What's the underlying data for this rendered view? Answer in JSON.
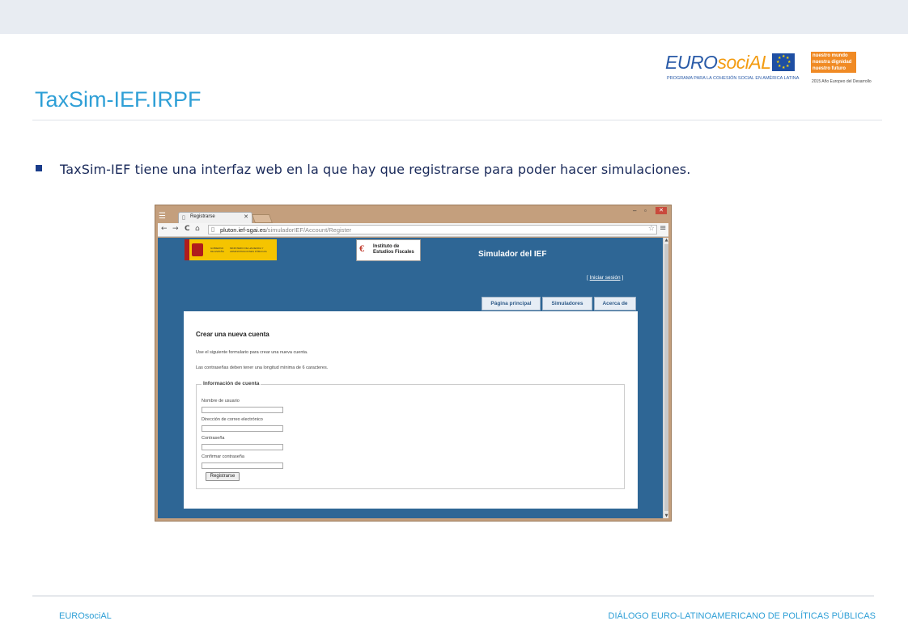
{
  "slide": {
    "title": "TaxSim-IEF.IRPF",
    "bullet": "TaxSim-IEF tiene una interfaz web en la que hay que registrarse para poder hacer simulaciones.",
    "accent_color": "#2e9fd6"
  },
  "logos": {
    "eurosocial_part1": "EURO",
    "eurosocial_part2": "sociAL",
    "eurosocial_sub": "PROGRAMA PARA LA COHESIÓN SOCIAL EN AMÉRICA LATINA",
    "nuestro_lines": [
      "nuestro mundo",
      "nuestra dignidad",
      "nuestro futuro"
    ],
    "nuestro_sub": "2015 Año Europeo del Desarrollo"
  },
  "browser": {
    "tab_label": "Registrarse",
    "url_host": "pluton.ief-sgai.es",
    "url_path": "/simuladorIEF/Account/Register",
    "site_title": "Simulador del IEF",
    "login_link": "Iniciar sesión",
    "gov_text": [
      "GOBIERNO DE ESPAÑA",
      "MINISTERIO DE HACIENDA Y ADMINISTRACIONES PÚBLICAS"
    ],
    "ief_lines": [
      "Instituto de",
      "Estudios Fiscales"
    ],
    "nav_tabs": [
      "Página principal",
      "Simuladores",
      "Acerca de"
    ],
    "form": {
      "heading": "Crear una nueva cuenta",
      "intro": "Use el siguiente formulario para crear una nueva cuenta.",
      "password_note": "Las contraseñas deben tener una longitud mínima de 6 caracteres.",
      "legend": "Información de cuenta",
      "fields": [
        "Nombre de usuario",
        "Dirección de correo electrónico",
        "Contraseña",
        "Confirmar contraseña"
      ],
      "submit": "Registrarse"
    }
  },
  "footer": {
    "left": "EUROsociAL",
    "right": "DIÁLOGO EURO-LATINOAMERICANO DE POLÍTICAS PÚBLICAS"
  }
}
